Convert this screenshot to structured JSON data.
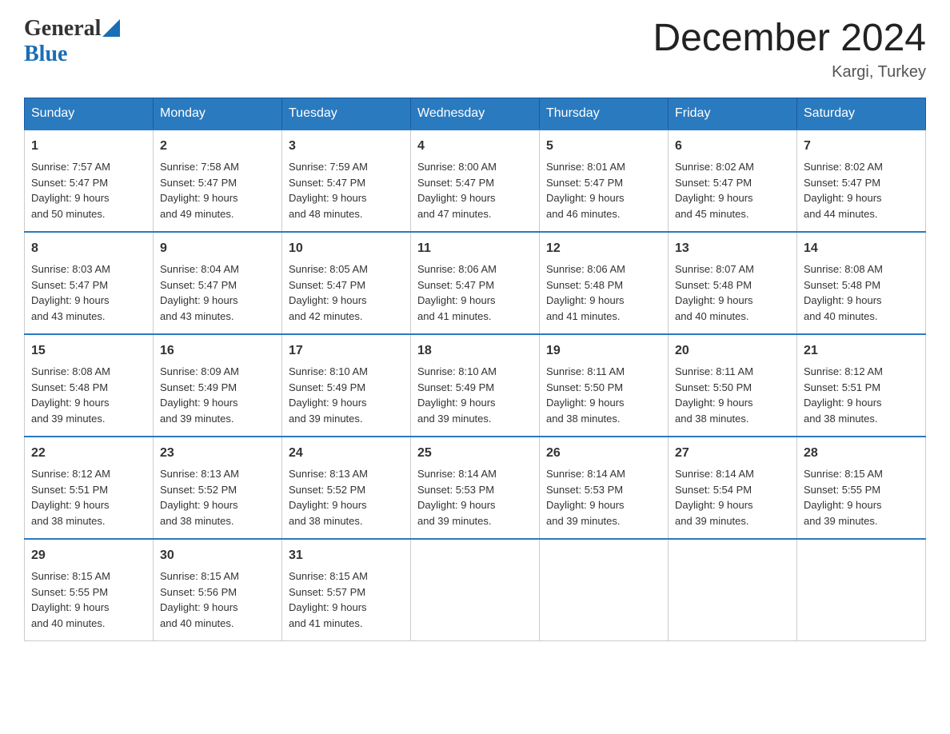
{
  "logo": {
    "general": "General",
    "blue": "Blue"
  },
  "title": "December 2024",
  "location": "Kargi, Turkey",
  "weekdays": [
    "Sunday",
    "Monday",
    "Tuesday",
    "Wednesday",
    "Thursday",
    "Friday",
    "Saturday"
  ],
  "weeks": [
    [
      {
        "day": "1",
        "sunrise": "Sunrise: 7:57 AM",
        "sunset": "Sunset: 5:47 PM",
        "daylight": "Daylight: 9 hours",
        "minutes": "and 50 minutes."
      },
      {
        "day": "2",
        "sunrise": "Sunrise: 7:58 AM",
        "sunset": "Sunset: 5:47 PM",
        "daylight": "Daylight: 9 hours",
        "minutes": "and 49 minutes."
      },
      {
        "day": "3",
        "sunrise": "Sunrise: 7:59 AM",
        "sunset": "Sunset: 5:47 PM",
        "daylight": "Daylight: 9 hours",
        "minutes": "and 48 minutes."
      },
      {
        "day": "4",
        "sunrise": "Sunrise: 8:00 AM",
        "sunset": "Sunset: 5:47 PM",
        "daylight": "Daylight: 9 hours",
        "minutes": "and 47 minutes."
      },
      {
        "day": "5",
        "sunrise": "Sunrise: 8:01 AM",
        "sunset": "Sunset: 5:47 PM",
        "daylight": "Daylight: 9 hours",
        "minutes": "and 46 minutes."
      },
      {
        "day": "6",
        "sunrise": "Sunrise: 8:02 AM",
        "sunset": "Sunset: 5:47 PM",
        "daylight": "Daylight: 9 hours",
        "minutes": "and 45 minutes."
      },
      {
        "day": "7",
        "sunrise": "Sunrise: 8:02 AM",
        "sunset": "Sunset: 5:47 PM",
        "daylight": "Daylight: 9 hours",
        "minutes": "and 44 minutes."
      }
    ],
    [
      {
        "day": "8",
        "sunrise": "Sunrise: 8:03 AM",
        "sunset": "Sunset: 5:47 PM",
        "daylight": "Daylight: 9 hours",
        "minutes": "and 43 minutes."
      },
      {
        "day": "9",
        "sunrise": "Sunrise: 8:04 AM",
        "sunset": "Sunset: 5:47 PM",
        "daylight": "Daylight: 9 hours",
        "minutes": "and 43 minutes."
      },
      {
        "day": "10",
        "sunrise": "Sunrise: 8:05 AM",
        "sunset": "Sunset: 5:47 PM",
        "daylight": "Daylight: 9 hours",
        "minutes": "and 42 minutes."
      },
      {
        "day": "11",
        "sunrise": "Sunrise: 8:06 AM",
        "sunset": "Sunset: 5:47 PM",
        "daylight": "Daylight: 9 hours",
        "minutes": "and 41 minutes."
      },
      {
        "day": "12",
        "sunrise": "Sunrise: 8:06 AM",
        "sunset": "Sunset: 5:48 PM",
        "daylight": "Daylight: 9 hours",
        "minutes": "and 41 minutes."
      },
      {
        "day": "13",
        "sunrise": "Sunrise: 8:07 AM",
        "sunset": "Sunset: 5:48 PM",
        "daylight": "Daylight: 9 hours",
        "minutes": "and 40 minutes."
      },
      {
        "day": "14",
        "sunrise": "Sunrise: 8:08 AM",
        "sunset": "Sunset: 5:48 PM",
        "daylight": "Daylight: 9 hours",
        "minutes": "and 40 minutes."
      }
    ],
    [
      {
        "day": "15",
        "sunrise": "Sunrise: 8:08 AM",
        "sunset": "Sunset: 5:48 PM",
        "daylight": "Daylight: 9 hours",
        "minutes": "and 39 minutes."
      },
      {
        "day": "16",
        "sunrise": "Sunrise: 8:09 AM",
        "sunset": "Sunset: 5:49 PM",
        "daylight": "Daylight: 9 hours",
        "minutes": "and 39 minutes."
      },
      {
        "day": "17",
        "sunrise": "Sunrise: 8:10 AM",
        "sunset": "Sunset: 5:49 PM",
        "daylight": "Daylight: 9 hours",
        "minutes": "and 39 minutes."
      },
      {
        "day": "18",
        "sunrise": "Sunrise: 8:10 AM",
        "sunset": "Sunset: 5:49 PM",
        "daylight": "Daylight: 9 hours",
        "minutes": "and 39 minutes."
      },
      {
        "day": "19",
        "sunrise": "Sunrise: 8:11 AM",
        "sunset": "Sunset: 5:50 PM",
        "daylight": "Daylight: 9 hours",
        "minutes": "and 38 minutes."
      },
      {
        "day": "20",
        "sunrise": "Sunrise: 8:11 AM",
        "sunset": "Sunset: 5:50 PM",
        "daylight": "Daylight: 9 hours",
        "minutes": "and 38 minutes."
      },
      {
        "day": "21",
        "sunrise": "Sunrise: 8:12 AM",
        "sunset": "Sunset: 5:51 PM",
        "daylight": "Daylight: 9 hours",
        "minutes": "and 38 minutes."
      }
    ],
    [
      {
        "day": "22",
        "sunrise": "Sunrise: 8:12 AM",
        "sunset": "Sunset: 5:51 PM",
        "daylight": "Daylight: 9 hours",
        "minutes": "and 38 minutes."
      },
      {
        "day": "23",
        "sunrise": "Sunrise: 8:13 AM",
        "sunset": "Sunset: 5:52 PM",
        "daylight": "Daylight: 9 hours",
        "minutes": "and 38 minutes."
      },
      {
        "day": "24",
        "sunrise": "Sunrise: 8:13 AM",
        "sunset": "Sunset: 5:52 PM",
        "daylight": "Daylight: 9 hours",
        "minutes": "and 38 minutes."
      },
      {
        "day": "25",
        "sunrise": "Sunrise: 8:14 AM",
        "sunset": "Sunset: 5:53 PM",
        "daylight": "Daylight: 9 hours",
        "minutes": "and 39 minutes."
      },
      {
        "day": "26",
        "sunrise": "Sunrise: 8:14 AM",
        "sunset": "Sunset: 5:53 PM",
        "daylight": "Daylight: 9 hours",
        "minutes": "and 39 minutes."
      },
      {
        "day": "27",
        "sunrise": "Sunrise: 8:14 AM",
        "sunset": "Sunset: 5:54 PM",
        "daylight": "Daylight: 9 hours",
        "minutes": "and 39 minutes."
      },
      {
        "day": "28",
        "sunrise": "Sunrise: 8:15 AM",
        "sunset": "Sunset: 5:55 PM",
        "daylight": "Daylight: 9 hours",
        "minutes": "and 39 minutes."
      }
    ],
    [
      {
        "day": "29",
        "sunrise": "Sunrise: 8:15 AM",
        "sunset": "Sunset: 5:55 PM",
        "daylight": "Daylight: 9 hours",
        "minutes": "and 40 minutes."
      },
      {
        "day": "30",
        "sunrise": "Sunrise: 8:15 AM",
        "sunset": "Sunset: 5:56 PM",
        "daylight": "Daylight: 9 hours",
        "minutes": "and 40 minutes."
      },
      {
        "day": "31",
        "sunrise": "Sunrise: 8:15 AM",
        "sunset": "Sunset: 5:57 PM",
        "daylight": "Daylight: 9 hours",
        "minutes": "and 41 minutes."
      },
      null,
      null,
      null,
      null
    ]
  ]
}
